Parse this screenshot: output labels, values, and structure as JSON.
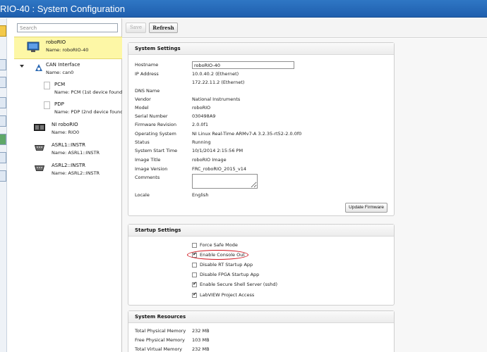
{
  "window": {
    "title": "RIO-40 : System Configuration"
  },
  "toolbar": {
    "save_label": "Save",
    "refresh_label": "Refresh"
  },
  "search": {
    "placeholder": "Search"
  },
  "tree": {
    "items": [
      {
        "name": "roboRIO",
        "subtitle": "Name: roboRIO-40",
        "icon": "monitor-icon",
        "selected": true
      },
      {
        "name": "CAN Interface",
        "subtitle": "Name: can0",
        "icon": "can-interface-icon"
      },
      {
        "name": "PCM",
        "subtitle": "Name: PCM (1st device found)",
        "icon": "blank-device-icon"
      },
      {
        "name": "PDP",
        "subtitle": "Name: PDP (2nd device found)",
        "icon": "blank-device-icon"
      },
      {
        "name": "NI roboRIO",
        "subtitle": "Name: RIO0",
        "icon": "rio-device-icon"
      },
      {
        "name": "ASRL1::INSTR",
        "subtitle": "Name: ASRL1::INSTR",
        "icon": "serial-port-icon"
      },
      {
        "name": "ASRL2::INSTR",
        "subtitle": "Name: ASRL2::INSTR",
        "icon": "serial-port-icon"
      }
    ]
  },
  "system_settings": {
    "title": "System Settings",
    "hostname_label": "Hostname",
    "hostname_value": "roboRIO-40",
    "ip_label": "IP Address",
    "ip_value_1": "10.0.40.2 (Ethernet)",
    "ip_value_2": "172.22.11.2 (Ethernet)",
    "dns_label": "DNS Name",
    "dns_value": "",
    "vendor_label": "Vendor",
    "vendor_value": "National Instruments",
    "model_label": "Model",
    "model_value": "roboRIO",
    "serial_label": "Serial Number",
    "serial_value": "030498A9",
    "firmware_label": "Firmware Revision",
    "firmware_value": "2.0.0f1",
    "os_label": "Operating System",
    "os_value": "NI Linux Real-Time ARMv7-A 3.2.35-rt52-2.0.0f0",
    "status_label": "Status",
    "status_value": "Running",
    "start_label": "System Start Time",
    "start_value": "10/1/2014 2:15:56 PM",
    "image_title_label": "Image Title",
    "image_title_value": "roboRIO Image",
    "image_version_label": "Image Version",
    "image_version_value": "FRC_roboRIO_2015_v14",
    "comments_label": "Comments",
    "comments_value": "",
    "locale_label": "Locale",
    "locale_value": "English",
    "update_firmware_label": "Update Firmware"
  },
  "startup_settings": {
    "title": "Startup Settings",
    "options": [
      {
        "label": "Force Safe Mode",
        "checked": false
      },
      {
        "label": "Enable Console Out",
        "checked": true
      },
      {
        "label": "Disable RT Startup App",
        "checked": false
      },
      {
        "label": "Disable FPGA Startup App",
        "checked": false
      },
      {
        "label": "Enable Secure Shell Server (sshd)",
        "checked": true
      },
      {
        "label": "LabVIEW Project Access",
        "checked": true
      }
    ]
  },
  "system_resources": {
    "title": "System Resources",
    "rows": [
      {
        "label": "Total Physical Memory",
        "value": "232 MB"
      },
      {
        "label": "Free Physical Memory",
        "value": "103 MB"
      },
      {
        "label": "Total Virtual Memory",
        "value": "232 MB"
      }
    ]
  },
  "colors": {
    "titlebar": "#2f77c4",
    "selection": "#fdf7a6",
    "annotation": "#d0121b"
  }
}
